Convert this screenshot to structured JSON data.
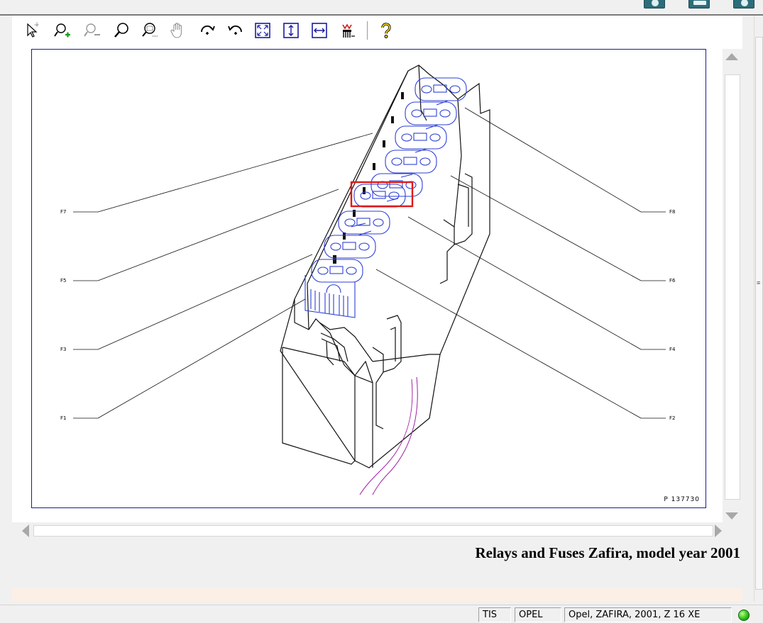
{
  "toolbar": {
    "tools": [
      {
        "name": "select-tool",
        "icon": "cursor-icon"
      },
      {
        "name": "zoom-in-tool",
        "icon": "zoom-in-icon"
      },
      {
        "name": "zoom-out-tool",
        "icon": "zoom-out-icon"
      },
      {
        "name": "magnifier-tool",
        "icon": "magnifier-icon"
      },
      {
        "name": "zoom-window-tool",
        "icon": "zoom-window-icon"
      },
      {
        "name": "pan-tool",
        "icon": "hand-icon"
      },
      {
        "name": "rotate-right-tool",
        "icon": "rotate-right-icon"
      },
      {
        "name": "rotate-left-tool",
        "icon": "rotate-left-icon"
      },
      {
        "name": "fit-all-tool",
        "icon": "fit-all-icon"
      },
      {
        "name": "fit-height-tool",
        "icon": "fit-height-icon"
      },
      {
        "name": "fit-width-tool",
        "icon": "fit-width-icon"
      },
      {
        "name": "highlight-tool",
        "icon": "highlight-icon"
      },
      {
        "name": "help-tool",
        "icon": "help-icon"
      }
    ]
  },
  "drawing": {
    "labels_left": [
      "F7",
      "F5",
      "F3",
      "F1"
    ],
    "labels_right": [
      "F8",
      "F6",
      "F4",
      "F2"
    ],
    "picture_code": "P 137730",
    "colors": {
      "frame": "#1a1a8c",
      "fuse_outline": "#2c3fd6",
      "highlight": "#e01818",
      "wire": "#a020a0",
      "housing": "#111111"
    }
  },
  "caption": "Relays and Fuses Zafira, model year 2001",
  "status": {
    "app": "TIS",
    "brand": "OPEL",
    "vehicle": "Opel, ZAFIRA, 2001, Z 16 XE",
    "indicator_color": "#2fc11a"
  }
}
